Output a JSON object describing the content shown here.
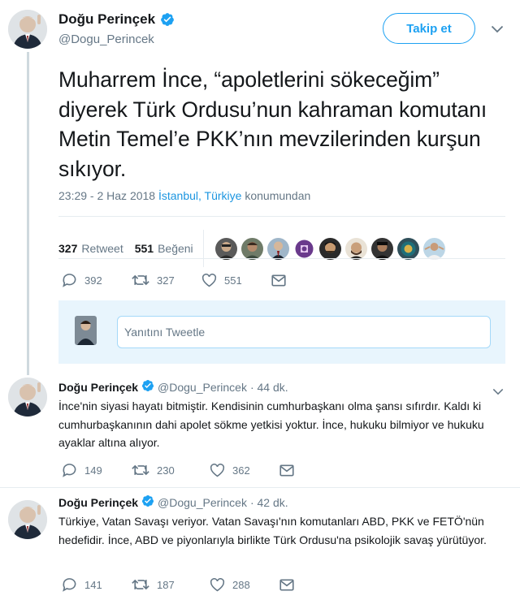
{
  "main_tweet": {
    "author_name": "Doğu Perinçek",
    "handle": "@Dogu_Perincek",
    "follow_label": "Takip et",
    "text": "Muharrem İnce, “apoletlerini sökeceğim” diyerek Türk Ordusu’nun kahraman komutanı Metin Temel’e PKK’nın mevzilerinden kurşun sıkıyor.",
    "timestamp": "23:29 - 2 Haz 2018",
    "location": "İstanbul, Türkiye",
    "location_suffix": "konumundan",
    "retweet_count": "327",
    "retweet_label": "Retweet",
    "like_count": "551",
    "like_label": "Beğeni",
    "actions": {
      "reply": "392",
      "retweet": "327",
      "like": "551"
    },
    "liker_avatars": [
      "liker-1",
      "liker-2",
      "liker-3",
      "liker-4",
      "liker-5",
      "liker-6",
      "liker-7",
      "liker-8",
      "liker-9"
    ]
  },
  "reply_box": {
    "placeholder": "Yanıtını Tweetle"
  },
  "replies": [
    {
      "author_name": "Doğu Perinçek",
      "handle": "@Dogu_Perincek",
      "time": "· 44 dk.",
      "text": "İnce'nin siyasi hayatı bitmiştir. Kendisinin cumhurbaşkanı olma şansı sıfırdır. Kaldı ki cumhurbaşkanının dahi apolet sökme yetkisi yoktur. İnce, hukuku bilmiyor ve hukuku ayaklar altına alıyor.",
      "actions": {
        "reply": "149",
        "retweet": "230",
        "like": "362"
      }
    },
    {
      "author_name": "Doğu Perinçek",
      "handle": "@Dogu_Perincek",
      "time": "· 42 dk.",
      "text": "Türkiye, Vatan Savaşı veriyor. Vatan Savaşı'nın komutanları ABD, PKK ve FETÖ'nün hedefidir. İnce, ABD ve piyonlarıyla birlikte Türk Ordusu'na psikolojik savaş yürütüyor.",
      "actions": {
        "reply": "141",
        "retweet": "187",
        "like": "288"
      }
    }
  ],
  "colors": {
    "accent": "#1da1f2",
    "link": "#1b95e0",
    "text_secondary": "#657786",
    "divider": "#e6ecf0",
    "reply_box_bg": "#e8f5fd"
  }
}
